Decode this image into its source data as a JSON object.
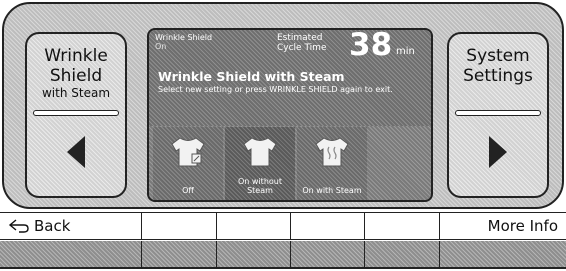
{
  "left_button": {
    "line1": "Wrinkle",
    "line2": "Shield",
    "line3": "with Steam",
    "arrow_icon": "left-triangle"
  },
  "right_button": {
    "line1": "System",
    "line2": "Settings",
    "arrow_icon": "right-triangle"
  },
  "screen": {
    "header_title": "Wrinkle Shield",
    "header_value": "On",
    "estimated_label": "Estimated Cycle Time",
    "time_value": "38",
    "time_unit": "min",
    "title": "Wrinkle Shield with Steam",
    "subtitle": "Select new setting or press WRINKLE SHIELD again to exit.",
    "options": [
      {
        "label": "Off",
        "icon": "shirt-off-icon",
        "selected": false
      },
      {
        "label": "On without Steam",
        "icon": "shirt-icon",
        "selected": true
      },
      {
        "label": "On with Steam",
        "icon": "shirt-steam-icon",
        "selected": false
      }
    ]
  },
  "bottom": {
    "back_label": "Back",
    "back_icon": "back-arrow-icon",
    "more_info_label": "More Info"
  }
}
